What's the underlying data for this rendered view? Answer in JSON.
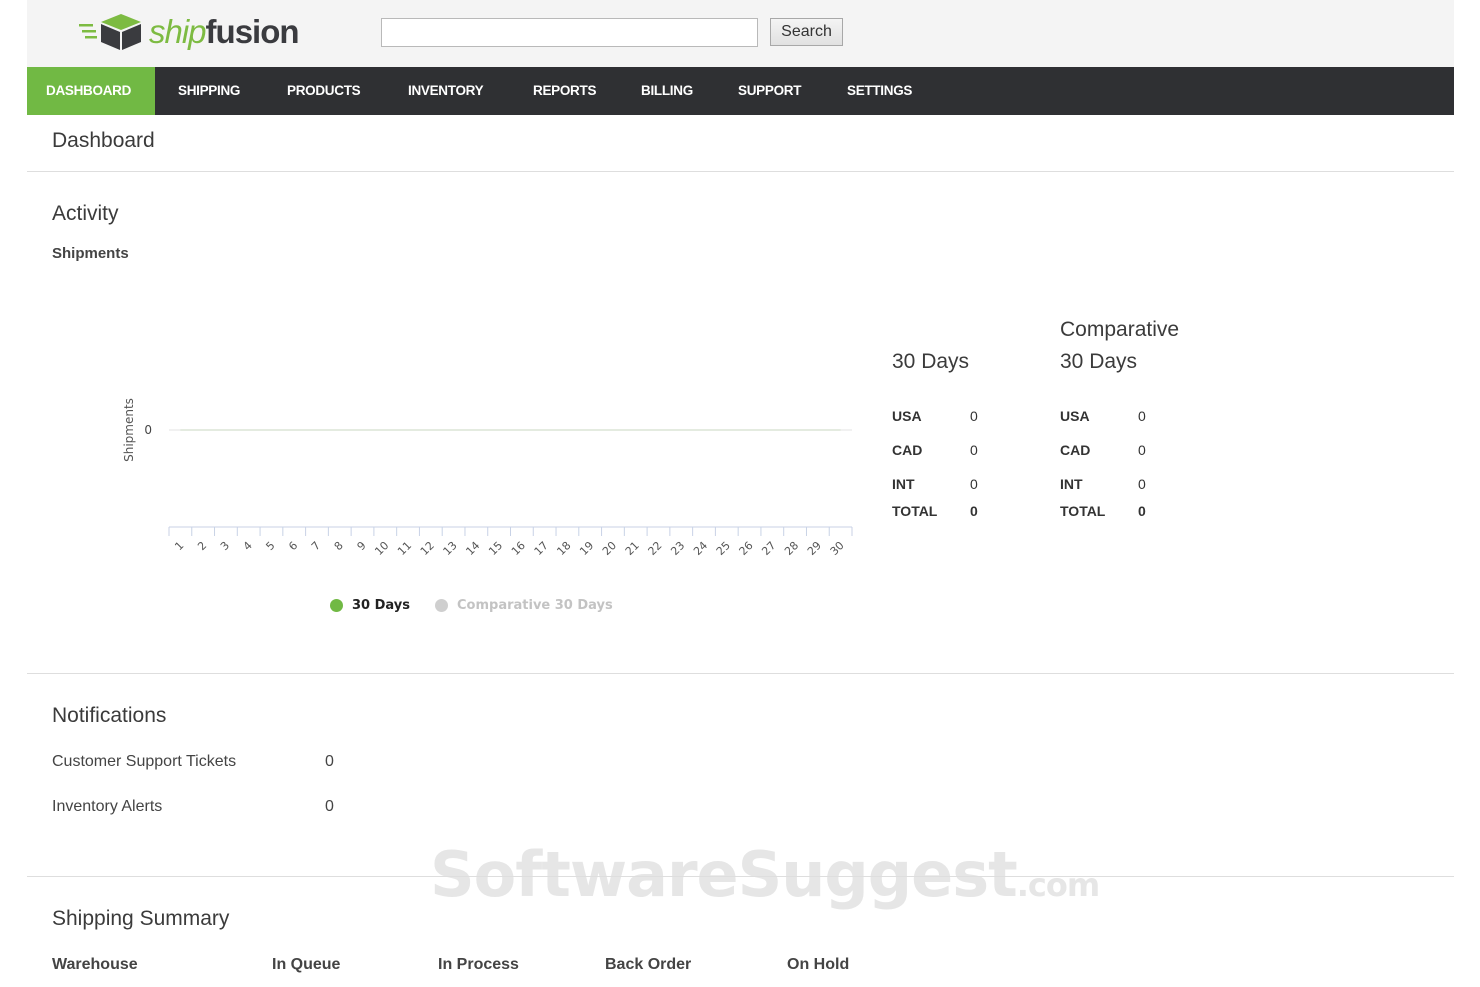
{
  "header": {
    "logo_ship": "ship",
    "logo_fusion": "fusion",
    "search": {
      "placeholder": "",
      "value": "",
      "button_label": "Search"
    }
  },
  "nav": {
    "items": [
      {
        "label": "DASHBOARD",
        "active": true
      },
      {
        "label": "SHIPPING",
        "active": false
      },
      {
        "label": "PRODUCTS",
        "active": false
      },
      {
        "label": "INVENTORY",
        "active": false
      },
      {
        "label": "REPORTS",
        "active": false
      },
      {
        "label": "BILLING",
        "active": false
      },
      {
        "label": "SUPPORT",
        "active": false
      },
      {
        "label": "SETTINGS",
        "active": false
      }
    ]
  },
  "page_title": "Dashboard",
  "activity": {
    "title": "Activity",
    "subtitle": "Shipments"
  },
  "chart_data": {
    "type": "line",
    "title": "",
    "xlabel": "",
    "ylabel": "Shipments",
    "x": [
      "1",
      "2",
      "3",
      "4",
      "5",
      "6",
      "7",
      "8",
      "9",
      "10",
      "11",
      "12",
      "13",
      "14",
      "15",
      "16",
      "17",
      "18",
      "19",
      "20",
      "21",
      "22",
      "23",
      "24",
      "25",
      "26",
      "27",
      "28",
      "29",
      "30"
    ],
    "y_ticks": [
      "0"
    ],
    "series": [
      {
        "name": "30 Days",
        "color": "#71b944",
        "values": [
          0,
          0,
          0,
          0,
          0,
          0,
          0,
          0,
          0,
          0,
          0,
          0,
          0,
          0,
          0,
          0,
          0,
          0,
          0,
          0,
          0,
          0,
          0,
          0,
          0,
          0,
          0,
          0,
          0,
          0
        ]
      },
      {
        "name": "Comparative 30 Days",
        "color": "#cfcfcf",
        "values": [
          0,
          0,
          0,
          0,
          0,
          0,
          0,
          0,
          0,
          0,
          0,
          0,
          0,
          0,
          0,
          0,
          0,
          0,
          0,
          0,
          0,
          0,
          0,
          0,
          0,
          0,
          0,
          0,
          0,
          0
        ]
      }
    ],
    "legend_position": "bottom-center",
    "grid": true
  },
  "stats": {
    "current": {
      "title_line1": "30 Days",
      "rows": [
        {
          "label": "USA",
          "value": "0"
        },
        {
          "label": "CAD",
          "value": "0"
        },
        {
          "label": "INT",
          "value": "0"
        }
      ],
      "total": {
        "label": "TOTAL",
        "value": "0"
      }
    },
    "comparative": {
      "title_line1": "Comparative",
      "title_line2": "30 Days",
      "rows": [
        {
          "label": "USA",
          "value": "0"
        },
        {
          "label": "CAD",
          "value": "0"
        },
        {
          "label": "INT",
          "value": "0"
        }
      ],
      "total": {
        "label": "TOTAL",
        "value": "0"
      }
    }
  },
  "notifications": {
    "title": "Notifications",
    "rows": [
      {
        "label": "Customer Support Tickets",
        "value": "0"
      },
      {
        "label": "Inventory Alerts",
        "value": "0"
      }
    ]
  },
  "shipping_summary": {
    "title": "Shipping Summary",
    "columns": [
      "Warehouse",
      "In Queue",
      "In Process",
      "Back Order",
      "On Hold"
    ]
  },
  "watermark": {
    "main": "SoftwareSuggest",
    "tld": ".com"
  },
  "colors": {
    "brand_green": "#71b944",
    "nav_bg": "#2f3033",
    "comparative_gray": "#cfcfcf"
  }
}
